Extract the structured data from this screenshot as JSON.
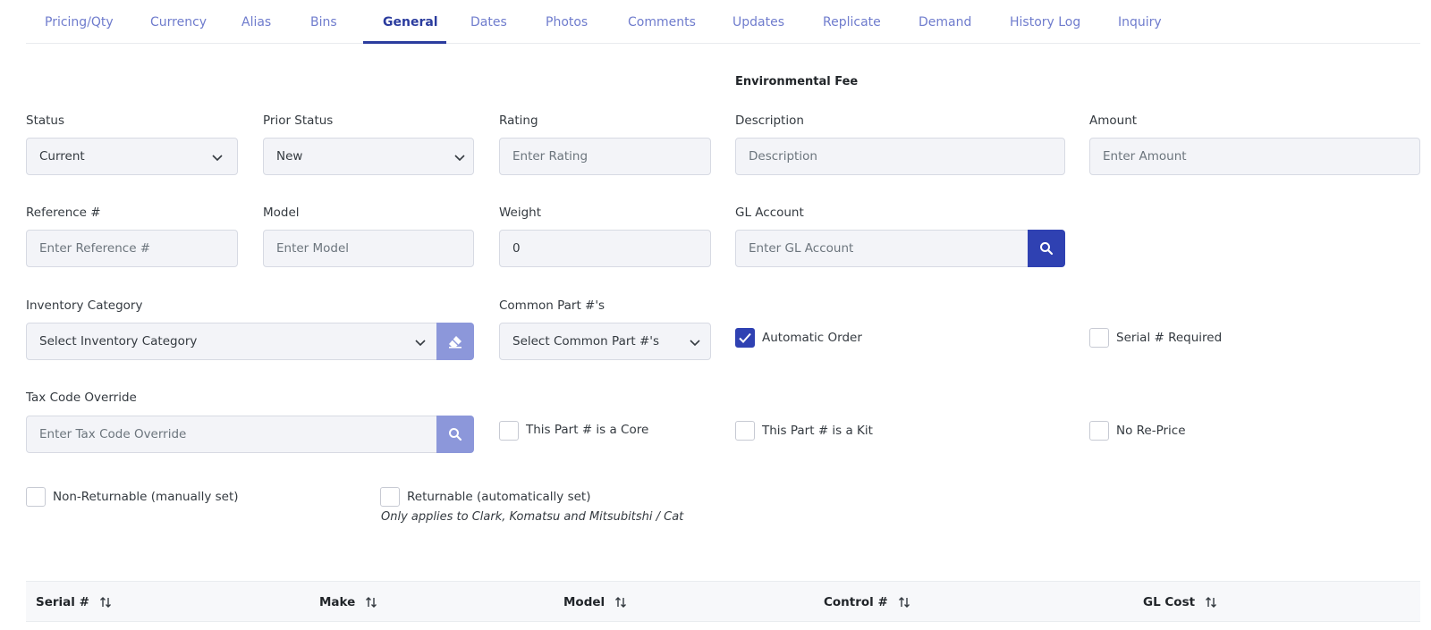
{
  "tabs": [
    {
      "label": "Pricing/Qty"
    },
    {
      "label": "Currency"
    },
    {
      "label": "Alias"
    },
    {
      "label": "Bins"
    },
    {
      "label": "General",
      "active": true
    },
    {
      "label": "Dates"
    },
    {
      "label": "Photos"
    },
    {
      "label": "Comments"
    },
    {
      "label": "Updates"
    },
    {
      "label": "Replicate"
    },
    {
      "label": "Demand"
    },
    {
      "label": "History Log"
    },
    {
      "label": "Inquiry"
    }
  ],
  "form": {
    "status": {
      "label": "Status",
      "value": "Current"
    },
    "prior_status": {
      "label": "Prior Status",
      "value": "New"
    },
    "rating": {
      "label": "Rating",
      "placeholder": "Enter Rating"
    },
    "environmental_fee": {
      "title": "Environmental Fee",
      "description": {
        "label": "Description",
        "placeholder": "Description"
      },
      "amount": {
        "label": "Amount",
        "placeholder": "Enter Amount"
      }
    },
    "reference": {
      "label": "Reference #",
      "placeholder": "Enter Reference #"
    },
    "model": {
      "label": "Model",
      "placeholder": "Enter Model"
    },
    "weight": {
      "label": "Weight",
      "value": "0"
    },
    "gl_account": {
      "label": "GL Account",
      "placeholder": "Enter GL Account"
    },
    "inventory_category": {
      "label": "Inventory Category",
      "value": "Select Inventory Category"
    },
    "common_part": {
      "label": "Common Part #'s",
      "value": "Select Common Part #'s"
    },
    "tax_code_override": {
      "label": "Tax Code Override",
      "placeholder": "Enter Tax Code Override"
    }
  },
  "checkboxes": {
    "automatic_order": {
      "label": "Automatic Order",
      "checked": true
    },
    "serial_required": {
      "label": "Serial # Required",
      "checked": false
    },
    "is_core": {
      "label": "This Part # is a Core",
      "checked": false
    },
    "is_kit": {
      "label": "This Part # is a Kit",
      "checked": false
    },
    "no_reprice": {
      "label": "No Re-Price",
      "checked": false
    },
    "non_returnable": {
      "label": "Non-Returnable (manually set)",
      "checked": false
    },
    "returnable": {
      "label": "Returnable (automatically set)",
      "checked": false,
      "note": "Only applies to Clark, Komatsu and Mitsubitshi / Cat"
    }
  },
  "table": {
    "columns": [
      "Serial #",
      "Make",
      "Model",
      "Control #",
      "GL Cost"
    ]
  },
  "colors": {
    "accent": "#2f41b2",
    "accent_light": "#8c97da",
    "tab_text": "#6f7ccd"
  }
}
